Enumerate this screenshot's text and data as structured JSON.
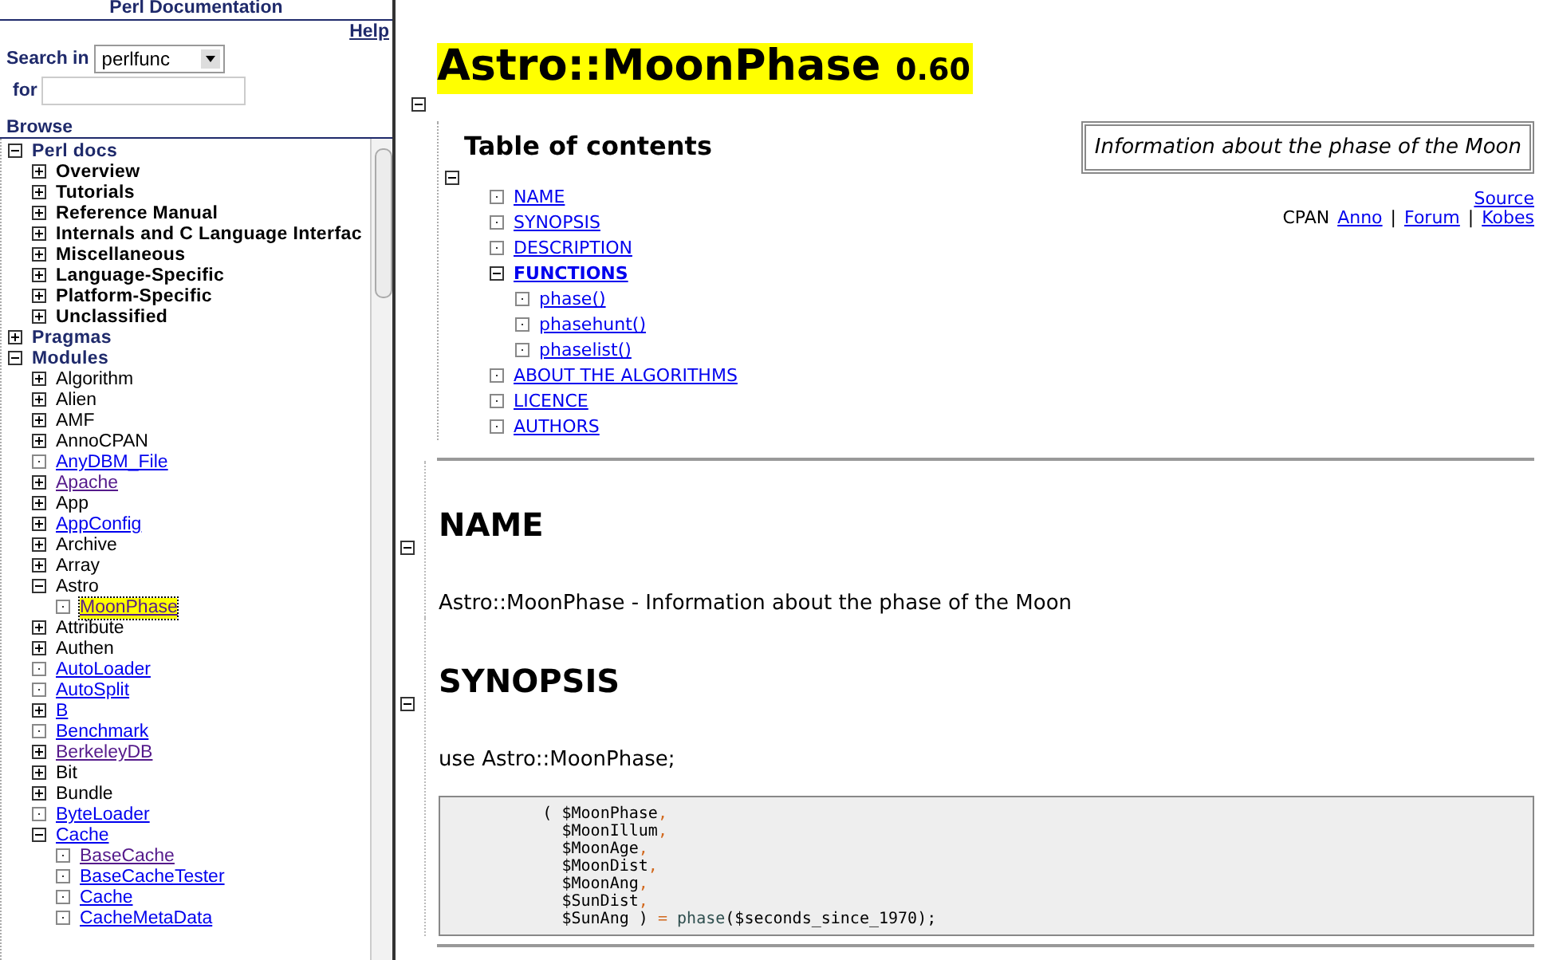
{
  "sidebar": {
    "title": "Perl Documentation",
    "help_link": "Help",
    "search": {
      "label": "Search in",
      "scope": "perlfunc",
      "for_label": "for"
    },
    "browse_label": "Browse",
    "tree": [
      {
        "label": "Perl docs",
        "kind": "branch",
        "expanded": true,
        "link": false,
        "selected": false,
        "bold_children": true,
        "children": [
          {
            "label": "Overview",
            "kind": "branch",
            "expanded": false,
            "link": false,
            "selected": false
          },
          {
            "label": "Tutorials",
            "kind": "branch",
            "expanded": false,
            "link": false,
            "selected": false
          },
          {
            "label": "Reference Manual",
            "kind": "branch",
            "expanded": false,
            "link": false,
            "selected": false
          },
          {
            "label": "Internals and C Language Interfac",
            "kind": "branch",
            "expanded": false,
            "link": false,
            "selected": false
          },
          {
            "label": "Miscellaneous",
            "kind": "branch",
            "expanded": false,
            "link": false,
            "selected": false
          },
          {
            "label": "Language-Specific",
            "kind": "branch",
            "expanded": false,
            "link": false,
            "selected": false
          },
          {
            "label": "Platform-Specific",
            "kind": "branch",
            "expanded": false,
            "link": false,
            "selected": false
          },
          {
            "label": "Unclassified",
            "kind": "branch",
            "expanded": false,
            "link": false,
            "selected": false
          }
        ]
      },
      {
        "label": "Pragmas",
        "kind": "branch",
        "expanded": false,
        "link": false,
        "selected": false
      },
      {
        "label": "Modules",
        "kind": "branch",
        "expanded": true,
        "link": false,
        "selected": false,
        "bold_children": false,
        "children": [
          {
            "label": "Algorithm",
            "kind": "branch",
            "expanded": false,
            "link": false,
            "selected": false
          },
          {
            "label": "Alien",
            "kind": "branch",
            "expanded": false,
            "link": false,
            "selected": false
          },
          {
            "label": "AMF",
            "kind": "branch",
            "expanded": false,
            "link": false,
            "selected": false
          },
          {
            "label": "AnnoCPAN",
            "kind": "branch",
            "expanded": false,
            "link": false,
            "selected": false
          },
          {
            "label": "AnyDBM_File",
            "kind": "leaf",
            "link": true,
            "visited": false,
            "selected": false
          },
          {
            "label": "Apache",
            "kind": "branch",
            "expanded": false,
            "link": true,
            "visited": true,
            "selected": false
          },
          {
            "label": "App",
            "kind": "branch",
            "expanded": false,
            "link": false,
            "selected": false
          },
          {
            "label": "AppConfig",
            "kind": "branch",
            "expanded": false,
            "link": true,
            "visited": false,
            "selected": false
          },
          {
            "label": "Archive",
            "kind": "branch",
            "expanded": false,
            "link": false,
            "selected": false
          },
          {
            "label": "Array",
            "kind": "branch",
            "expanded": false,
            "link": false,
            "selected": false
          },
          {
            "label": "Astro",
            "kind": "branch",
            "expanded": true,
            "link": false,
            "selected": false,
            "bold_children": false,
            "children": [
              {
                "label": "MoonPhase",
                "kind": "leaf",
                "link": true,
                "visited": true,
                "selected": true
              }
            ]
          },
          {
            "label": "Attribute",
            "kind": "branch",
            "expanded": false,
            "link": false,
            "selected": false
          },
          {
            "label": "Authen",
            "kind": "branch",
            "expanded": false,
            "link": false,
            "selected": false
          },
          {
            "label": "AutoLoader",
            "kind": "leaf",
            "link": true,
            "visited": false,
            "selected": false
          },
          {
            "label": "AutoSplit",
            "kind": "leaf",
            "link": true,
            "visited": false,
            "selected": false
          },
          {
            "label": "B",
            "kind": "branch",
            "expanded": false,
            "link": true,
            "visited": false,
            "selected": false
          },
          {
            "label": "Benchmark",
            "kind": "leaf",
            "link": true,
            "visited": false,
            "selected": false
          },
          {
            "label": "BerkeleyDB",
            "kind": "branch",
            "expanded": false,
            "link": true,
            "visited": true,
            "selected": false
          },
          {
            "label": "Bit",
            "kind": "branch",
            "expanded": false,
            "link": false,
            "selected": false
          },
          {
            "label": "Bundle",
            "kind": "branch",
            "expanded": false,
            "link": false,
            "selected": false
          },
          {
            "label": "ByteLoader",
            "kind": "leaf",
            "link": true,
            "visited": false,
            "selected": false
          },
          {
            "label": "Cache",
            "kind": "branch",
            "expanded": true,
            "link": true,
            "visited": false,
            "selected": false,
            "bold_children": false,
            "children": [
              {
                "label": "BaseCache",
                "kind": "leaf",
                "link": true,
                "visited": true,
                "selected": false
              },
              {
                "label": "BaseCacheTester",
                "kind": "leaf",
                "link": true,
                "visited": false,
                "selected": false
              },
              {
                "label": "Cache",
                "kind": "leaf",
                "link": true,
                "visited": false,
                "selected": false
              },
              {
                "label": "CacheMetaData",
                "kind": "leaf",
                "link": true,
                "visited": false,
                "selected": false
              }
            ]
          }
        ]
      }
    ]
  },
  "main": {
    "title": "Astro::MoonPhase",
    "version": "0.60",
    "toc": {
      "heading": "Table of contents",
      "items": [
        {
          "label": "NAME",
          "kind": "leaf",
          "selected": false
        },
        {
          "label": "SYNOPSIS",
          "kind": "leaf",
          "selected": false
        },
        {
          "label": "DESCRIPTION",
          "kind": "leaf",
          "selected": false
        },
        {
          "label": "FUNCTIONS",
          "kind": "branch",
          "expanded": true,
          "selected": true,
          "children": [
            {
              "label": "phase()",
              "kind": "leaf",
              "selected": false
            },
            {
              "label": "phasehunt()",
              "kind": "leaf",
              "selected": false
            },
            {
              "label": "phaselist()",
              "kind": "leaf",
              "selected": false
            }
          ]
        },
        {
          "label": "ABOUT THE ALGORITHMS",
          "kind": "leaf",
          "selected": false
        },
        {
          "label": "LICENCE",
          "kind": "leaf",
          "selected": false
        },
        {
          "label": "AUTHORS",
          "kind": "leaf",
          "selected": false
        }
      ]
    },
    "abstract": "Information about the phase of the Moon",
    "source_link": "Source",
    "cpan": [
      {
        "text": "CPAN",
        "kind": "label"
      },
      {
        "text": "Anno",
        "kind": "link"
      },
      {
        "text": "|",
        "kind": "separator"
      },
      {
        "text": "Forum",
        "kind": "link"
      },
      {
        "text": "|",
        "kind": "separator"
      },
      {
        "text": "Kobes",
        "kind": "link"
      }
    ],
    "sections": [
      {
        "heading": "NAME",
        "paragraphs": [
          "Astro::MoonPhase - Information about the phase of the Moon"
        ]
      },
      {
        "heading": "SYNOPSIS",
        "paragraphs": [
          "use Astro::MoonPhase;"
        ],
        "code": [
          "        ( $MoonPhase,",
          "          $MoonIllum,",
          "          $MoonAge,",
          "          $MoonDist,",
          "          $MoonAng,",
          "          $SunDist,",
          "          $SunAng ) = phase($seconds_since_1970);"
        ]
      }
    ]
  }
}
